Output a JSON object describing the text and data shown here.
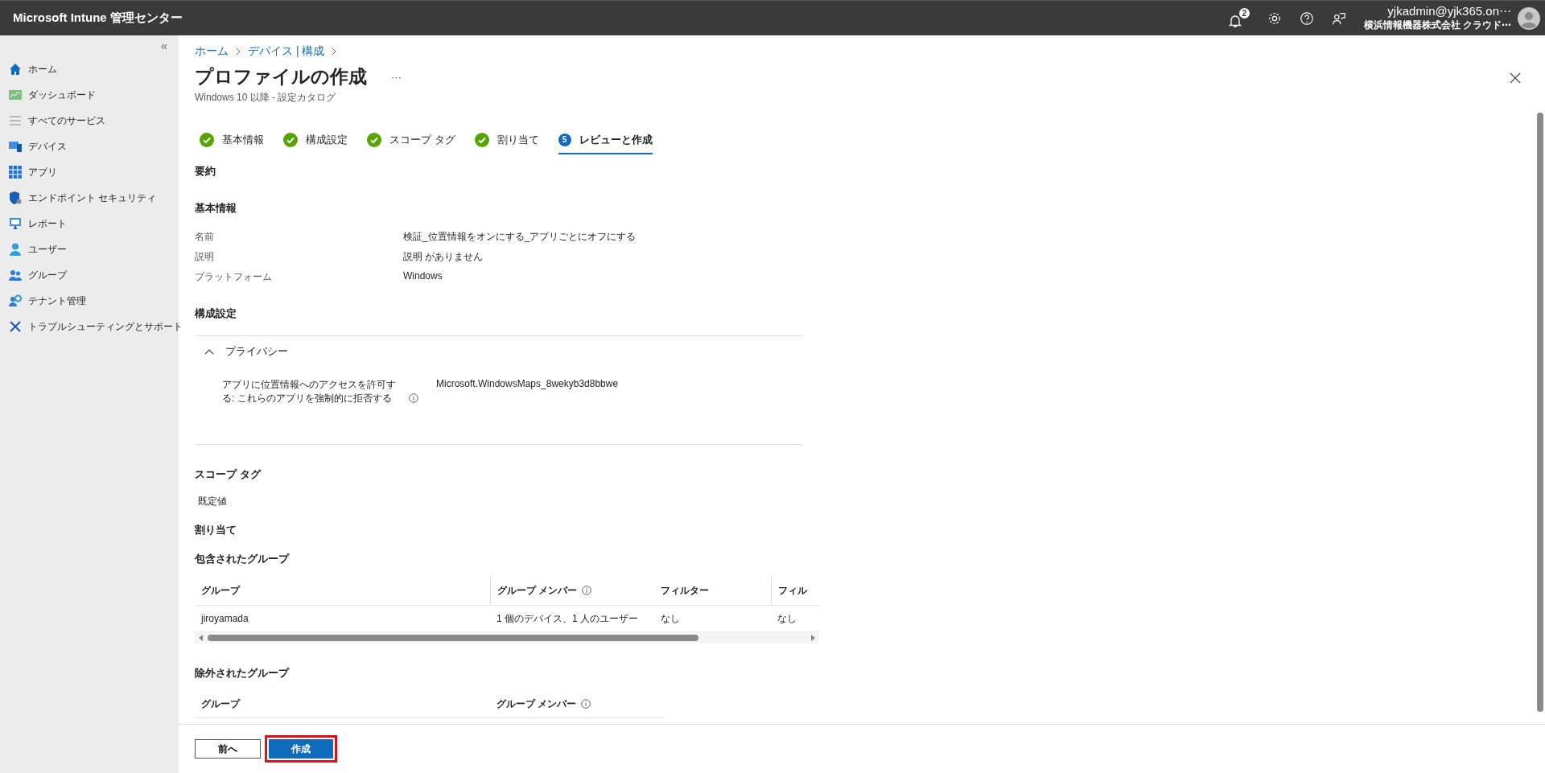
{
  "app_title": "Microsoft Intune 管理センター",
  "header": {
    "notification_count": "2",
    "user_email": "yjkadmin@yjk365.on⋯",
    "user_org": "横浜情報機器株式会社 クラウド⋯"
  },
  "sidebar": {
    "collapse": "«",
    "items": [
      {
        "label": "ホーム",
        "selected": false
      },
      {
        "label": "ダッシュボード",
        "selected": false
      },
      {
        "label": "すべてのサービス",
        "selected": false
      },
      {
        "label": "デバイス",
        "selected": false
      },
      {
        "label": "アプリ",
        "selected": false
      },
      {
        "label": "エンドポイント セキュリティ",
        "selected": false
      },
      {
        "label": "レポート",
        "selected": false
      },
      {
        "label": "ユーザー",
        "selected": false
      },
      {
        "label": "グループ",
        "selected": false
      },
      {
        "label": "テナント管理",
        "selected": false
      },
      {
        "label": "トラブルシューティングとサポート",
        "selected": false
      }
    ]
  },
  "breadcrumb": [
    "ホーム",
    "デバイス | 構成"
  ],
  "page": {
    "title": "プロファイルの作成",
    "more": "···",
    "subtitle": "Windows 10 以降 - 設定カタログ"
  },
  "steps": [
    {
      "label": "基本情報",
      "completed": true,
      "selected": false
    },
    {
      "label": "構成設定",
      "completed": true,
      "selected": false
    },
    {
      "label": "スコープ タグ",
      "completed": true,
      "selected": false
    },
    {
      "label": "割り当て",
      "completed": true,
      "selected": false
    },
    {
      "label": "レビューと作成",
      "number": "5",
      "completed": false,
      "selected": true
    }
  ],
  "summary_heading": "要約",
  "basics": {
    "heading": "基本情報",
    "rows": [
      {
        "label": "名前",
        "value": "検証_位置情報をオンにする_アプリごとにオフにする"
      },
      {
        "label": "説明",
        "value": "説明 がありません"
      },
      {
        "label": "プラットフォーム",
        "value": "Windows"
      }
    ]
  },
  "configuration": {
    "heading": "構成設定",
    "category": "プライバシー",
    "expanded": true,
    "settings": [
      {
        "label": "アプリに位置情報へのアクセスを許可する: これらのアプリを強制的に拒否する",
        "value": "Microsoft.WindowsMaps_8wekyb3d8bbwe"
      }
    ]
  },
  "scope_tags": {
    "heading": "スコープ タグ",
    "value": "既定値"
  },
  "assignments": {
    "heading": "割り当て",
    "included": {
      "heading": "包含されたグループ",
      "columns": [
        {
          "label": "グループ",
          "info": false
        },
        {
          "label": "グループ メンバー",
          "info": true
        },
        {
          "label": "フィルター",
          "info": false
        },
        {
          "label": "フィル",
          "info": false
        }
      ],
      "rows": [
        [
          "jiroyamada",
          "1 個のデバイス、1 人のユーザー",
          "なし",
          "なし"
        ]
      ]
    },
    "excluded": {
      "heading": "除外されたグループ",
      "columns": [
        {
          "label": "グループ",
          "info": false
        },
        {
          "label": "グループ メンバー",
          "info": true
        }
      ]
    }
  },
  "footer": {
    "buttons": [
      {
        "label": "前へ",
        "primary": false
      },
      {
        "label": "作成",
        "primary": true
      }
    ]
  }
}
